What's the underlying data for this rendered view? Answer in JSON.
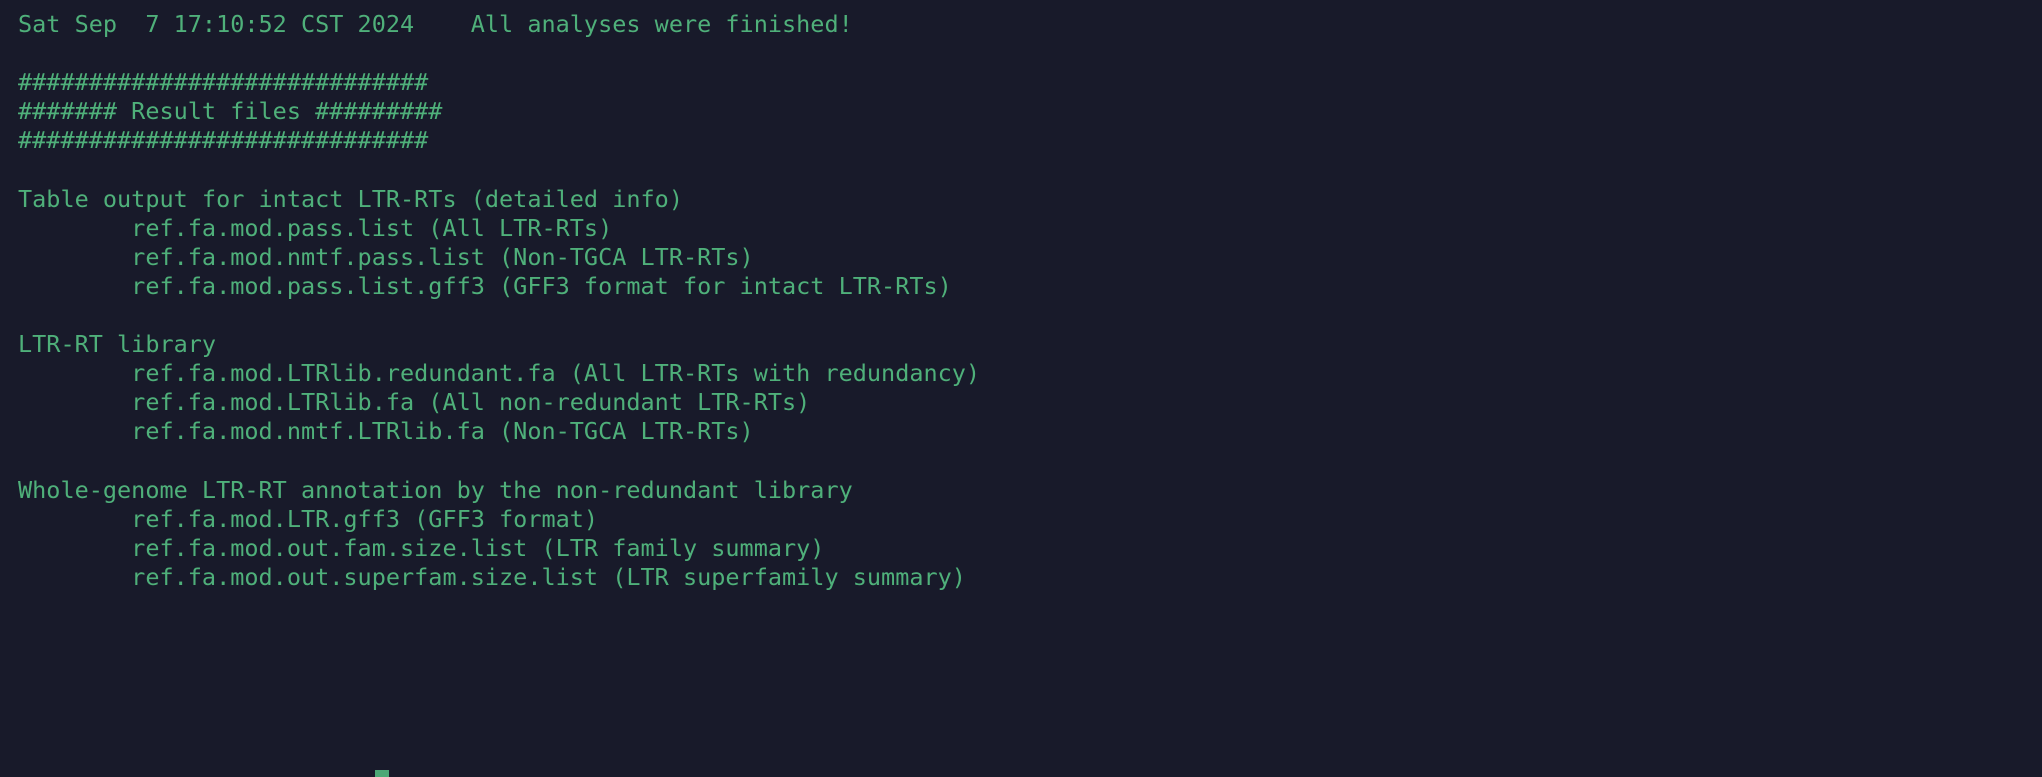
{
  "terminal": {
    "background_color": "#181a2a",
    "text_color": "#4fb07a",
    "cursor": {
      "name": "text-cursor",
      "color": "#4fb07a"
    },
    "header": {
      "timestamp": "Sat Sep  7 17:10:52 CST 2024",
      "status_message": "All analyses were finished!",
      "full_line": "Sat Sep  7 17:10:52 CST 2024    All analyses were finished!"
    },
    "banner": {
      "top_rule": "#############################",
      "title_line": "####### Result files #########",
      "bottom_rule": "#############################",
      "title": "Result files"
    },
    "sections": [
      {
        "heading": "Table output for intact LTR-RTs (detailed info)",
        "files": [
          {
            "name": "ref.fa.mod.pass.list",
            "description": "(All LTR-RTs)",
            "line": "        ref.fa.mod.pass.list (All LTR-RTs)"
          },
          {
            "name": "ref.fa.mod.nmtf.pass.list",
            "description": "(Non-TGCA LTR-RTs)",
            "line": "        ref.fa.mod.nmtf.pass.list (Non-TGCA LTR-RTs)"
          },
          {
            "name": "ref.fa.mod.pass.list.gff3",
            "description": "(GFF3 format for intact LTR-RTs)",
            "line": "        ref.fa.mod.pass.list.gff3 (GFF3 format for intact LTR-RTs)"
          }
        ]
      },
      {
        "heading": "LTR-RT library",
        "files": [
          {
            "name": "ref.fa.mod.LTRlib.redundant.fa",
            "description": "(All LTR-RTs with redundancy)",
            "line": "        ref.fa.mod.LTRlib.redundant.fa (All LTR-RTs with redundancy)"
          },
          {
            "name": "ref.fa.mod.LTRlib.fa",
            "description": "(All non-redundant LTR-RTs)",
            "line": "        ref.fa.mod.LTRlib.fa (All non-redundant LTR-RTs)"
          },
          {
            "name": "ref.fa.mod.nmtf.LTRlib.fa",
            "description": "(Non-TGCA LTR-RTs)",
            "line": "        ref.fa.mod.nmtf.LTRlib.fa (Non-TGCA LTR-RTs)"
          }
        ]
      },
      {
        "heading": "Whole-genome LTR-RT annotation by the non-redundant library",
        "files": [
          {
            "name": "ref.fa.mod.LTR.gff3",
            "description": "(GFF3 format)",
            "line": "        ref.fa.mod.LTR.gff3 (GFF3 format)"
          },
          {
            "name": "ref.fa.mod.out.fam.size.list",
            "description": "(LTR family summary)",
            "line": "        ref.fa.mod.out.fam.size.list (LTR family summary)"
          },
          {
            "name": "ref.fa.mod.out.superfam.size.list",
            "description": "(LTR superfamily summary)",
            "line": "        ref.fa.mod.out.superfam.size.list (LTR superfamily summary)"
          }
        ]
      }
    ],
    "lines": [
      "Sat Sep  7 17:10:52 CST 2024    All analyses were finished!",
      "",
      "#############################",
      "####### Result files #########",
      "#############################",
      "",
      "Table output for intact LTR-RTs (detailed info)",
      "        ref.fa.mod.pass.list (All LTR-RTs)",
      "        ref.fa.mod.nmtf.pass.list (Non-TGCA LTR-RTs)",
      "        ref.fa.mod.pass.list.gff3 (GFF3 format for intact LTR-RTs)",
      "",
      "LTR-RT library",
      "        ref.fa.mod.LTRlib.redundant.fa (All LTR-RTs with redundancy)",
      "        ref.fa.mod.LTRlib.fa (All non-redundant LTR-RTs)",
      "        ref.fa.mod.nmtf.LTRlib.fa (Non-TGCA LTR-RTs)",
      "",
      "Whole-genome LTR-RT annotation by the non-redundant library",
      "        ref.fa.mod.LTR.gff3 (GFF3 format)",
      "        ref.fa.mod.out.fam.size.list (LTR family summary)",
      "        ref.fa.mod.out.superfam.size.list (LTR superfamily summary)"
    ]
  }
}
